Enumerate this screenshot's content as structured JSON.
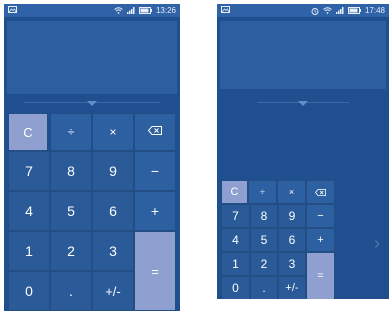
{
  "left": {
    "status": {
      "time": "13:26",
      "icons": [
        "notification-icon",
        "wifi-icon",
        "signal-icon",
        "battery-icon"
      ]
    },
    "keys": {
      "clear": "C",
      "divide": "÷",
      "multiply": "×",
      "backspace": "⌫",
      "seven": "7",
      "eight": "8",
      "nine": "9",
      "minus": "−",
      "four": "4",
      "five": "5",
      "six": "6",
      "plus": "+",
      "one": "1",
      "two": "2",
      "three": "3",
      "equals": "=",
      "zero": "0",
      "dot": ".",
      "sign": "+/-"
    }
  },
  "right": {
    "status": {
      "time": "17:48",
      "icons": [
        "notification-icon",
        "alarm-icon",
        "wifi-icon",
        "signal-icon",
        "battery-icon"
      ]
    },
    "keys": {
      "clear": "C",
      "divide": "÷",
      "multiply": "×",
      "backspace": "⌫",
      "seven": "7",
      "eight": "8",
      "nine": "9",
      "minus": "−",
      "four": "4",
      "five": "5",
      "six": "6",
      "plus": "+",
      "one": "1",
      "two": "2",
      "three": "3",
      "equals": "=",
      "zero": "0",
      "dot": ".",
      "sign": "+/-"
    },
    "chevron": "›"
  },
  "colors": {
    "background": "#1f4f8e",
    "display": "#2d5f9f",
    "accent_key": "#8fa0d0"
  }
}
